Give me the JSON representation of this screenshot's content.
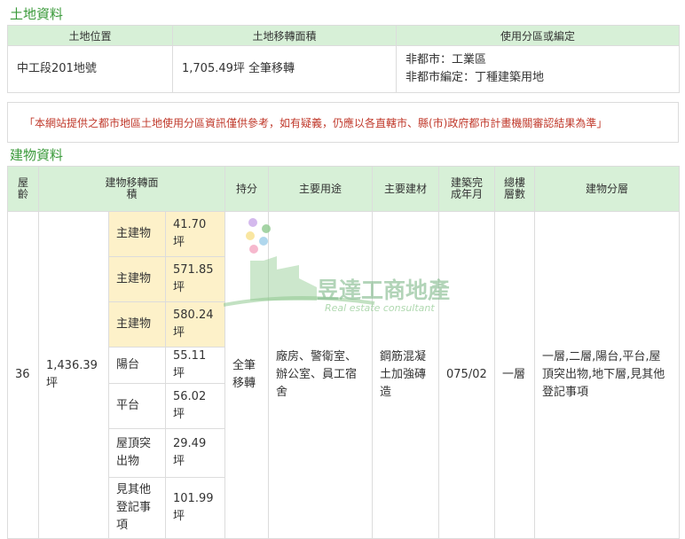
{
  "land_section": {
    "title": "土地資料",
    "headers": [
      "土地位置",
      "土地移轉面積",
      "使用分區或編定"
    ],
    "row": {
      "location": "中工段201地號",
      "area": "1,705.49坪 全筆移轉",
      "zoning_line1": "非都市：工業區",
      "zoning_line2": "非都市編定：丁種建築用地"
    }
  },
  "notice": "「本網站提供之都市地區土地使用分區資訊僅供參考，如有疑義，仍應以各直轄市、縣(市)政府都市計畫機關審認結果為準」",
  "building_section": {
    "title": "建物資料",
    "headers": {
      "age": "屋齡",
      "transfer_area": "建物移轉面積",
      "ownership": "持分",
      "main_use": "主要用途",
      "main_material": "主要建材",
      "completion": "建築完成年月",
      "floors": "總樓層數",
      "floor_split": "建物分層"
    },
    "row": {
      "age": "36",
      "total_area": "1,436.39坪",
      "ownership": "全筆移轉",
      "main_use": "廠房、警衛室、辦公室、員工宿舍",
      "main_material": "鋼筋混凝土加強磚造",
      "completion": "075/02",
      "floors": "一層",
      "floor_split": "一層,二層,陽台,平台,屋頂突出物,地下層,見其他登記事項"
    },
    "sub_items": [
      {
        "label": "主建物",
        "value": "41.70坪",
        "main": true
      },
      {
        "label": "主建物",
        "value": "571.85坪",
        "main": true
      },
      {
        "label": "主建物",
        "value": "580.24坪",
        "main": true
      },
      {
        "label": "陽台",
        "value": "55.11坪",
        "main": false
      },
      {
        "label": "平台",
        "value": "56.02坪",
        "main": false
      },
      {
        "label": "屋頂突出物",
        "value": "29.49坪",
        "main": false
      },
      {
        "label": "見其他登記事項",
        "value": "101.99坪",
        "main": false
      }
    ]
  },
  "watermark": {
    "name": "昱達工商地產",
    "sub": "Real estate consultant",
    "colors": {
      "green": "#8fc98f",
      "pink": "#f4a6c1",
      "yellow": "#f7e08a",
      "blue": "#9ccde8",
      "purple": "#c9a8e8"
    }
  }
}
